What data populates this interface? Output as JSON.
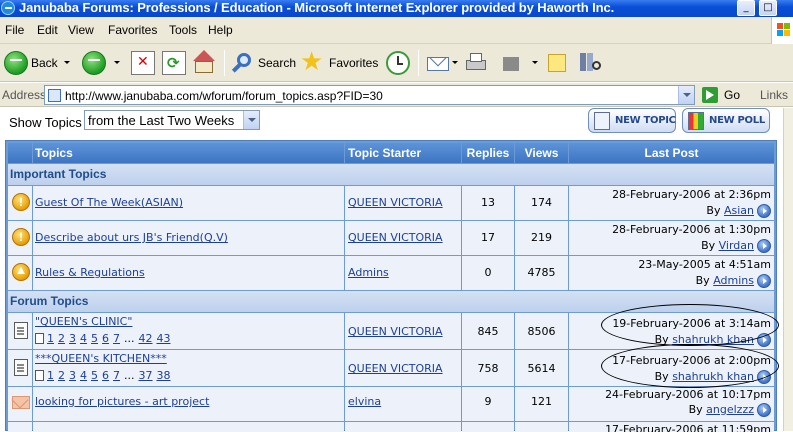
{
  "window": {
    "title": "Janubaba Forums: Professions / Education - Microsoft Internet Explorer provided by Haworth Inc.",
    "minimize": "_",
    "maximize": "□"
  },
  "menu": [
    "File",
    "Edit",
    "View",
    "Favorites",
    "Tools",
    "Help"
  ],
  "toolbar": {
    "back": "Back",
    "search": "Search",
    "favorites": "Favorites"
  },
  "address": {
    "label": "Address",
    "url": "http://www.janubaba.com/wforum/forum_topics.asp?FID=30",
    "go": "Go",
    "links": "Links"
  },
  "filter": {
    "label": "Show Topics",
    "selected": "from the Last Two Weeks"
  },
  "buttons": {
    "new_topic": "NEW TOPIC",
    "new_poll": "NEW POLL"
  },
  "columns": {
    "topics": "Topics",
    "starter": "Topic Starter",
    "replies": "Replies",
    "views": "Views",
    "last_post": "Last Post"
  },
  "sections": {
    "important": "Important Topics",
    "forum": "Forum Topics"
  },
  "important_topics": [
    {
      "icon": "alert-icon",
      "title": "Guest Of The Week(ASIAN)",
      "starter": "QUEEN VICTORIA",
      "replies": "13",
      "views": "174",
      "last_date": "28-February-2006 at 2:36pm",
      "by_label": "By",
      "last_by": "Asian"
    },
    {
      "icon": "alert-icon",
      "title": "Describe about urs JB's Friend(Q.V)",
      "starter": "QUEEN VICTORIA",
      "replies": "17",
      "views": "219",
      "last_date": "28-February-2006 at 1:30pm",
      "by_label": "By",
      "last_by": "Virdan"
    },
    {
      "icon": "upload-icon",
      "title": "Rules & Regulations",
      "starter": "Admins",
      "replies": "0",
      "views": "4785",
      "last_date": "23-May-2005 at 4:51am",
      "by_label": "By",
      "last_by": "Admins"
    }
  ],
  "forum_topics": [
    {
      "icon": "doc-icon",
      "title": "\"QUEEN's CLINIC\"",
      "pages": [
        "1",
        "2",
        "3",
        "4",
        "5",
        "6",
        "7",
        "...",
        "42",
        "43"
      ],
      "starter": "QUEEN VICTORIA",
      "replies": "845",
      "views": "8506",
      "last_date": "19-February-2006 at 3:14am",
      "by_label": "By",
      "last_by": "shahrukh khan"
    },
    {
      "icon": "doc-icon",
      "title": "***QUEEN's KITCHEN***",
      "pages": [
        "1",
        "2",
        "3",
        "4",
        "5",
        "6",
        "7",
        "...",
        "37",
        "38"
      ],
      "starter": "QUEEN VICTORIA",
      "replies": "758",
      "views": "5614",
      "last_date": "17-February-2006 at 2:00pm",
      "by_label": "By",
      "last_by": "shahrukh khan"
    },
    {
      "icon": "mail-icon",
      "title": "looking for pictures - art project",
      "starter": "elvina",
      "replies": "9",
      "views": "121",
      "last_date": "24-February-2006 at 10:17pm",
      "by_label": "By",
      "last_by": "angelzzz"
    },
    {
      "icon": "doc-icon",
      "title": "",
      "starter": "",
      "replies": "",
      "views": "",
      "last_date": "17-February-2006 at 11:59pm",
      "by_label": "",
      "last_by": ""
    }
  ]
}
